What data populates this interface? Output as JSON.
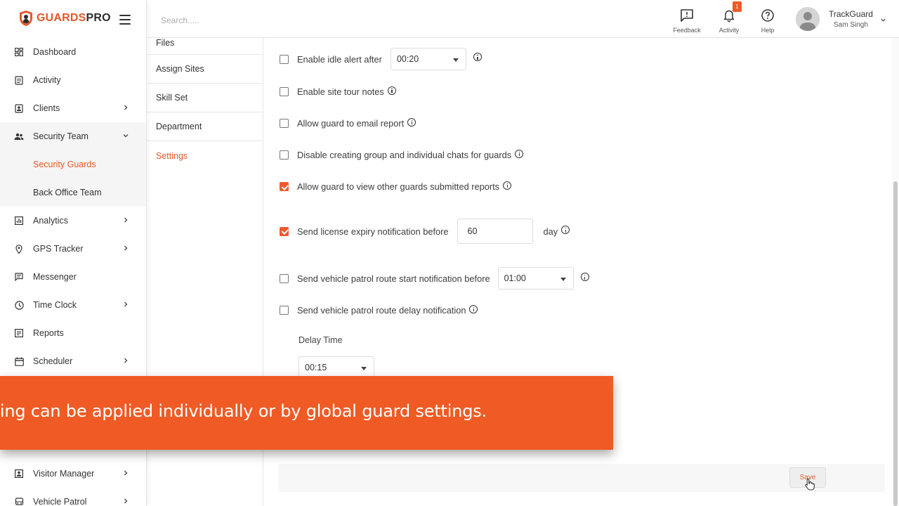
{
  "brand": {
    "name_accent": "GUARDS",
    "name_rest": "PRO",
    "accent_color": "#e8572a"
  },
  "sidebar": {
    "items": [
      {
        "label": "Dashboard",
        "icon": "dashboard-icon",
        "has_chevron": false
      },
      {
        "label": "Activity",
        "icon": "activity-icon",
        "has_chevron": false
      },
      {
        "label": "Clients",
        "icon": "clients-icon",
        "has_chevron": true
      },
      {
        "label": "Security Team",
        "icon": "team-icon",
        "has_chevron": true,
        "expanded": true
      },
      {
        "label": "Analytics",
        "icon": "analytics-icon",
        "has_chevron": true
      },
      {
        "label": "GPS Tracker",
        "icon": "location-pin-icon",
        "has_chevron": true
      },
      {
        "label": "Messenger",
        "icon": "messenger-icon",
        "has_chevron": false
      },
      {
        "label": "Time Clock",
        "icon": "clock-icon",
        "has_chevron": true
      },
      {
        "label": "Reports",
        "icon": "reports-icon",
        "has_chevron": false
      },
      {
        "label": "Scheduler",
        "icon": "calendar-icon",
        "has_chevron": true
      },
      {
        "label": "Visitor Manager",
        "icon": "visitor-icon",
        "has_chevron": true
      },
      {
        "label": "Vehicle Patrol",
        "icon": "vehicle-icon",
        "has_chevron": true
      }
    ],
    "subitems": [
      {
        "label": "Security Guards",
        "active": true
      },
      {
        "label": "Back Office Team",
        "active": false
      }
    ]
  },
  "topbar": {
    "search_placeholder": "Search.....",
    "feedback_label": "Feedback",
    "activity_label": "Activity",
    "activity_badge": "1",
    "help_label": "Help",
    "user_org": "TrackGuard",
    "user_name": "Sam Singh"
  },
  "submenu": {
    "items": [
      "Files",
      "Assign Sites",
      "Skill Set",
      "Department",
      "Settings"
    ],
    "active": "Settings"
  },
  "settings": {
    "idle_alert": {
      "label": "Enable idle alert after",
      "checked": false,
      "value": "00:20"
    },
    "site_tour_notes": {
      "label": "Enable site tour notes",
      "checked": false
    },
    "email_report": {
      "label": "Allow guard to email report",
      "checked": false
    },
    "disable_chats": {
      "label": "Disable creating group and individual chats for guards",
      "checked": false
    },
    "view_reports": {
      "label": "Allow guard to view other guards submitted reports",
      "checked": true
    },
    "license_expiry": {
      "label": "Send license expiry notification before",
      "checked": true,
      "value": "60",
      "unit": "day"
    },
    "patrol_start": {
      "label": "Send vehicle patrol route start notification before",
      "checked": false,
      "value": "01:00"
    },
    "patrol_delay": {
      "label": "Send vehicle patrol route delay notification",
      "checked": false
    },
    "delay_time": {
      "label": "Delay Time",
      "value": "00:15"
    }
  },
  "save_label": "Save",
  "caption": "e setting can be applied individually or by global guard settings."
}
